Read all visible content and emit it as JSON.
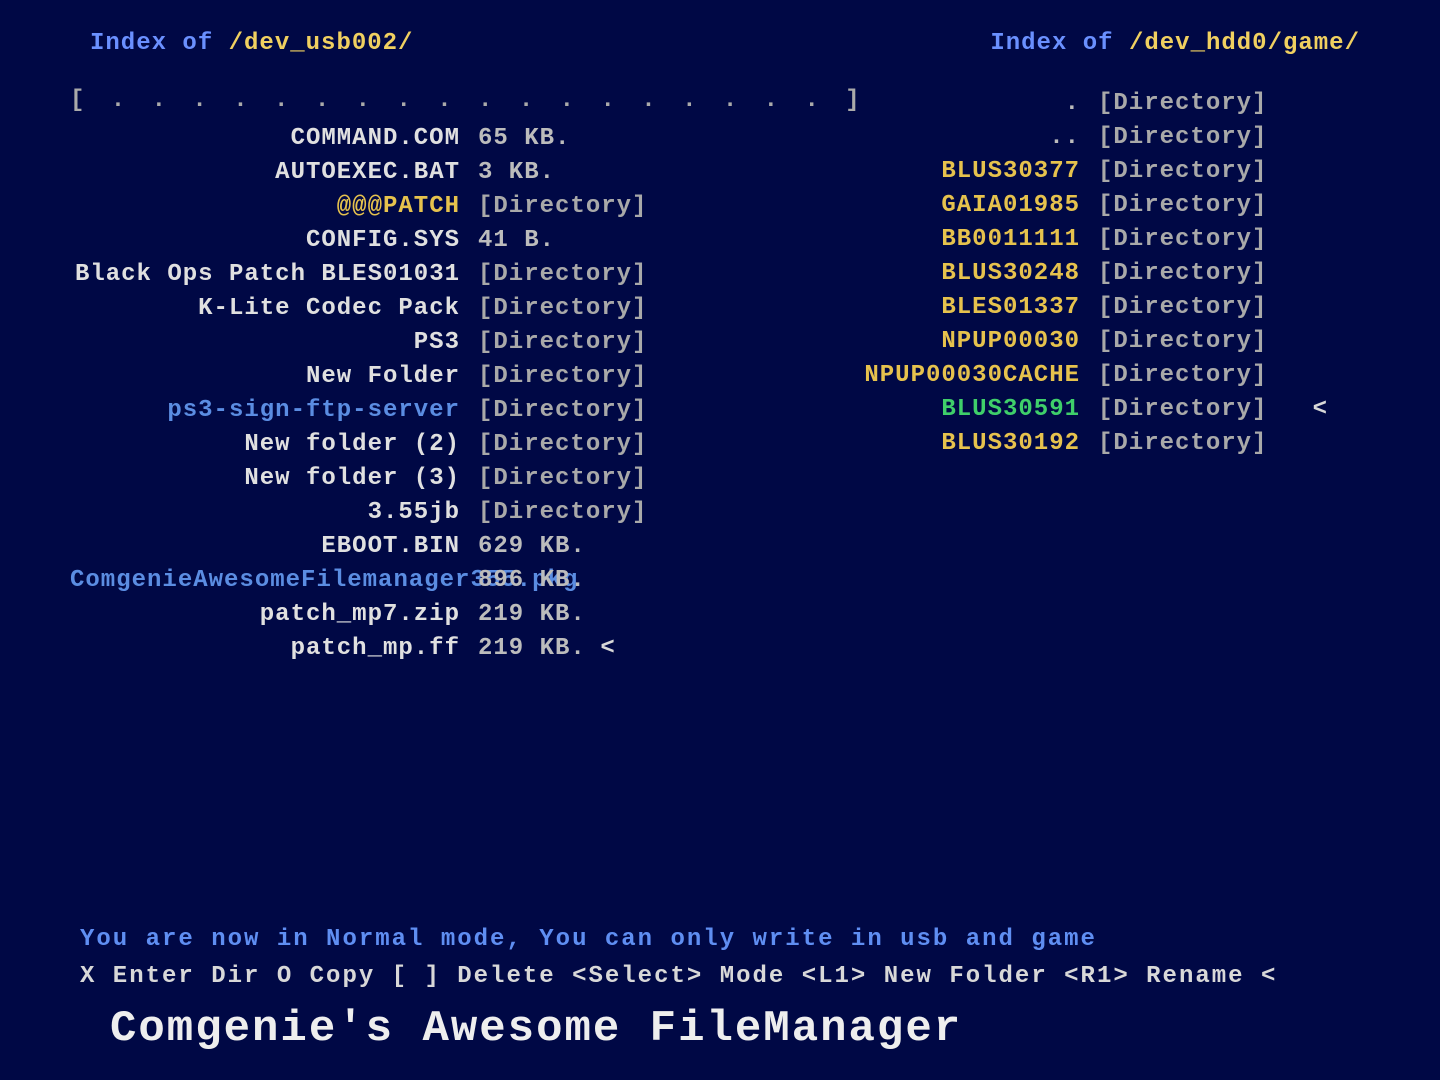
{
  "left": {
    "header_prefix": "Index of ",
    "path": "/dev_usb002/",
    "dots": "[ . . . . . . . . . . . . . . . . . . ]",
    "items": [
      {
        "name": "COMMAND.COM",
        "size": "65 KB.",
        "color": "c-white"
      },
      {
        "name": "AUTOEXEC.BAT",
        "size": "3 KB.",
        "color": "c-white"
      },
      {
        "name": "@@@PATCH",
        "size": "[Directory]",
        "color": "c-yellow"
      },
      {
        "name": "CONFIG.SYS",
        "size": "41 B.",
        "color": "c-white"
      },
      {
        "name": "Black Ops Patch BLES01031",
        "size": "[Directory]",
        "color": "c-white"
      },
      {
        "name": "K-Lite Codec Pack",
        "size": "[Directory]",
        "color": "c-white"
      },
      {
        "name": "PS3",
        "size": "[Directory]",
        "color": "c-white"
      },
      {
        "name": "New Folder",
        "size": "[Directory]",
        "color": "c-white"
      },
      {
        "name": "ps3-sign-ftp-server",
        "size": "[Directory]",
        "color": "c-blue"
      },
      {
        "name": "New folder (2)",
        "size": "[Directory]",
        "color": "c-white"
      },
      {
        "name": "New folder (3)",
        "size": "[Directory]",
        "color": "c-white"
      },
      {
        "name": "3.55jb",
        "size": "[Directory]",
        "color": "c-white"
      },
      {
        "name": "EBOOT.BIN",
        "size": "629 KB.",
        "color": "c-white"
      },
      {
        "name": "ComgenieAwesomeFilemanager355.pkg",
        "size": "896 KB.",
        "color": "c-blue"
      },
      {
        "name": "patch_mp7.zip",
        "size": "219 KB.",
        "color": "c-white"
      },
      {
        "name": "patch_mp.ff",
        "size": "219 KB.",
        "color": "c-white",
        "cursor": "<"
      }
    ]
  },
  "right": {
    "header_prefix": "Index of ",
    "path": "/dev_hdd0/game/",
    "items": [
      {
        "name": ".",
        "size": "[Directory]",
        "color": "c-dim"
      },
      {
        "name": "..",
        "size": "[Directory]",
        "color": "c-dim"
      },
      {
        "name": "BLUS30377",
        "size": "[Directory]",
        "color": "c-yellow"
      },
      {
        "name": "GAIA01985",
        "size": "[Directory]",
        "color": "c-yellow"
      },
      {
        "name": "BB0011111",
        "size": "[Directory]",
        "color": "c-yellow"
      },
      {
        "name": "BLUS30248",
        "size": "[Directory]",
        "color": "c-yellow"
      },
      {
        "name": "BLES01337",
        "size": "[Directory]",
        "color": "c-yellow"
      },
      {
        "name": "NPUP00030",
        "size": "[Directory]",
        "color": "c-yellow"
      },
      {
        "name": "NPUP00030CACHE",
        "size": "[Directory]",
        "color": "c-yellow"
      },
      {
        "name": "BLUS30591",
        "size": "[Directory]",
        "color": "c-green",
        "cursor": "<"
      },
      {
        "name": "BLUS30192",
        "size": "[Directory]",
        "color": "c-yellow"
      }
    ]
  },
  "footer": {
    "status": "You are now in Normal mode, You can only write in usb and game",
    "controls": "X Enter Dir  O Copy  [ ] Delete <Select> Mode <L1> New Folder <R1> Rename <",
    "title": "Comgenie's Awesome FileManager"
  }
}
